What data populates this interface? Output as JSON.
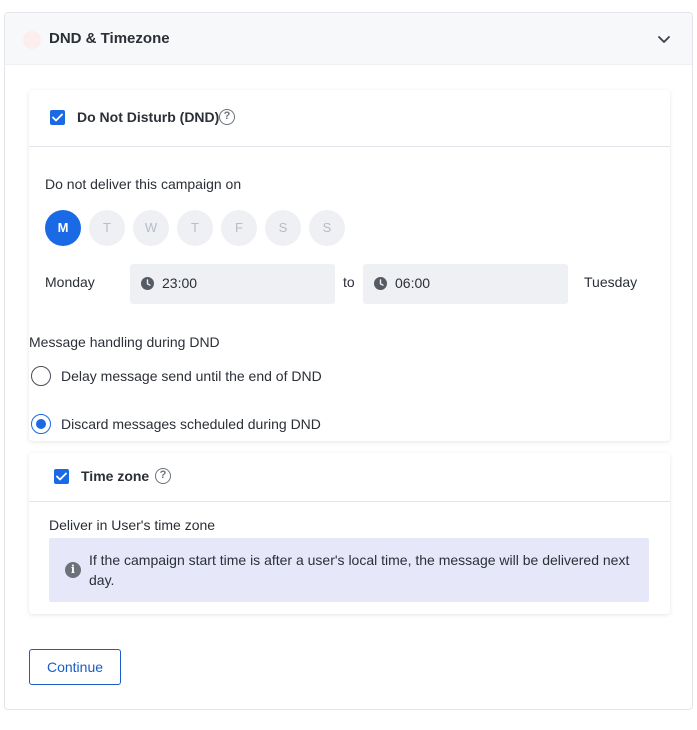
{
  "section": {
    "title": "DND & Timezone",
    "collapse_icon": "chevron-down-icon"
  },
  "dnd": {
    "title": "Do Not Disturb (DND)",
    "enabled": true,
    "help": "?",
    "days_label": "Do not deliver this campaign on",
    "days": [
      {
        "label": "M",
        "selected": true
      },
      {
        "label": "T",
        "selected": false
      },
      {
        "label": "W",
        "selected": false
      },
      {
        "label": "T",
        "selected": false
      },
      {
        "label": "F",
        "selected": false
      },
      {
        "label": "S",
        "selected": false
      },
      {
        "label": "S",
        "selected": false
      }
    ],
    "start_day": "Monday",
    "start_time": "23:00",
    "to_label": "to",
    "end_time": "06:00",
    "end_day": "Tuesday",
    "handling_label": "Message handling during DND",
    "options": [
      {
        "label": "Delay message send until the end of DND",
        "selected": false
      },
      {
        "label": "Discard messages scheduled during DND",
        "selected": true
      }
    ]
  },
  "timezone": {
    "title": "Time zone",
    "enabled": true,
    "help": "?",
    "deliver_label": "Deliver in User's time zone",
    "info_icon": "i",
    "info_text": "If the campaign start time is after a user's local time, the message will be delivered next day."
  },
  "actions": {
    "continue_label": "Continue"
  },
  "colors": {
    "accent": "#1a6ae6",
    "info_bg": "#e6e8fa"
  }
}
